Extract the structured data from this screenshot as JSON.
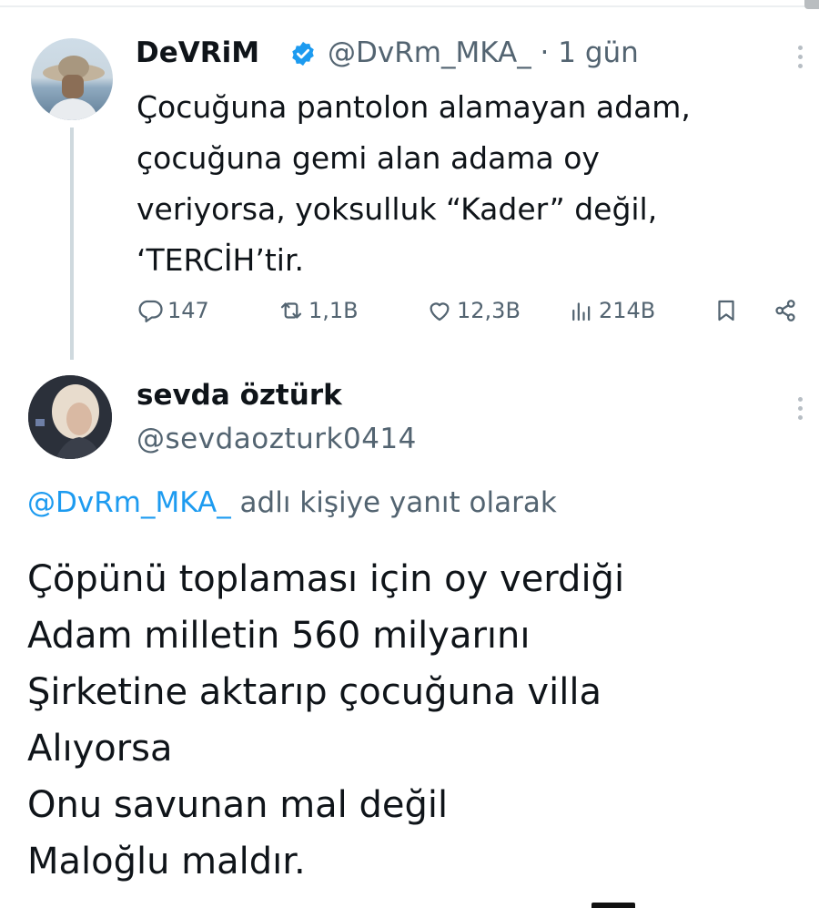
{
  "tweet1": {
    "name": "DeVRiM",
    "handle_line": "@DvRm_MKA_ · 1 gün",
    "lines": [
      "Çocuğuna pantolon alamayan adam,",
      "çocuğuna gemi alan adama oy",
      "veriyorsa, yoksulluk “Kader” değil,",
      "‘TERCİH’tir."
    ],
    "stats": {
      "replies": "147",
      "reposts": "1,1B",
      "likes": "12,3B",
      "views": "214B"
    }
  },
  "tweet2": {
    "name": "sevda öztürk",
    "handle": "@sevdaozturk0414",
    "reply_to_handle": "@DvRm_MKA_",
    "reply_to_suffix": " adlı kişiye yanıt olarak",
    "lines": [
      "Çöpünü toplaması için oy verdiği",
      "Adam milletin 560 milyarını",
      "Şirketine aktarıp çocuğuna villa",
      "Alıyorsa",
      "Onu savunan mal değil",
      "Maloğlu maldır."
    ]
  },
  "colors": {
    "accent": "#1d9bf0",
    "text": "#0f1419",
    "muted": "#536471"
  },
  "icons": [
    "verified-badge-icon",
    "reply-icon",
    "repost-icon",
    "like-icon",
    "views-icon",
    "bookmark-icon",
    "share-icon",
    "more-icon"
  ]
}
